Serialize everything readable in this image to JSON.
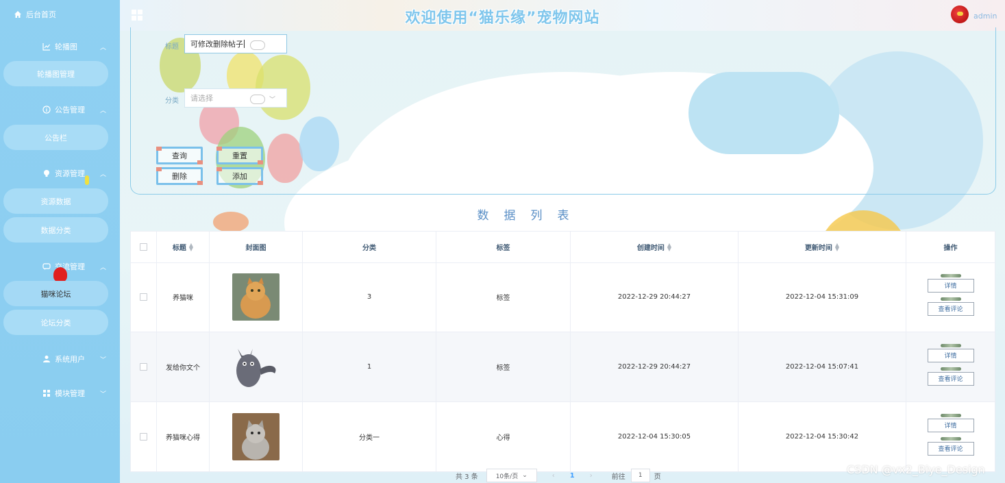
{
  "header": {
    "site_title": "欢迎使用“猫乐缘”宠物网站",
    "username": "admin"
  },
  "sidebar": {
    "home_label": "后台首页",
    "groups": [
      {
        "label": "轮播图",
        "icon": "chart-icon",
        "items": [
          "轮播图管理"
        ]
      },
      {
        "label": "公告管理",
        "icon": "info-icon",
        "items": [
          "公告栏"
        ]
      },
      {
        "label": "资源管理",
        "icon": "bulb-icon",
        "items": [
          "资源数据",
          "数据分类"
        ]
      },
      {
        "label": "交流管理",
        "icon": "chat-icon",
        "items": [
          "猫咪论坛",
          "论坛分类"
        ]
      },
      {
        "label": "系统用户",
        "icon": "user-icon",
        "items": []
      },
      {
        "label": "模块管理",
        "icon": "grid-icon",
        "items": []
      }
    ],
    "active_item": "猫咪论坛"
  },
  "search": {
    "title_label": "标题",
    "title_value": "可修改删除帖子",
    "category_label": "分类",
    "category_placeholder": "请选择",
    "buttons": {
      "query": "查询",
      "reset": "重置",
      "delete": "删除",
      "add": "添加"
    }
  },
  "list_title": "数据列表",
  "table": {
    "columns": [
      "标题",
      "封面图",
      "分类",
      "标签",
      "创建时间",
      "更新时间",
      "操作"
    ],
    "rows": [
      {
        "title": "养猫咪",
        "category": "3",
        "tag": "标签",
        "created": "2022-12-29 20:44:27",
        "updated": "2022-12-04 15:31:09",
        "cover": "orange-cat"
      },
      {
        "title": "发给你文个",
        "category": "1",
        "tag": "标签",
        "created": "2022-12-29 20:44:27",
        "updated": "2022-12-04 15:07:41",
        "cover": "grey-cartoon-cat"
      },
      {
        "title": "养猫咪心得",
        "category": "分类一",
        "tag": "心得",
        "created": "2022-12-04 15:30:05",
        "updated": "2022-12-04 15:30:42",
        "cover": "fluffy-kitten"
      }
    ],
    "op_detail": "详情",
    "op_comments": "查看评论"
  },
  "pagination": {
    "total": "共 3 条",
    "page_size": "10条/页",
    "current_page": "1",
    "goto_label": "前往",
    "goto_value": "1",
    "page_suffix": "页"
  },
  "watermark": "CSDN @vx2_Biye_Design",
  "colors": {
    "sidebar": "#8fd0f2",
    "accent": "#7ac0ea",
    "title": "#7fc6ec"
  }
}
